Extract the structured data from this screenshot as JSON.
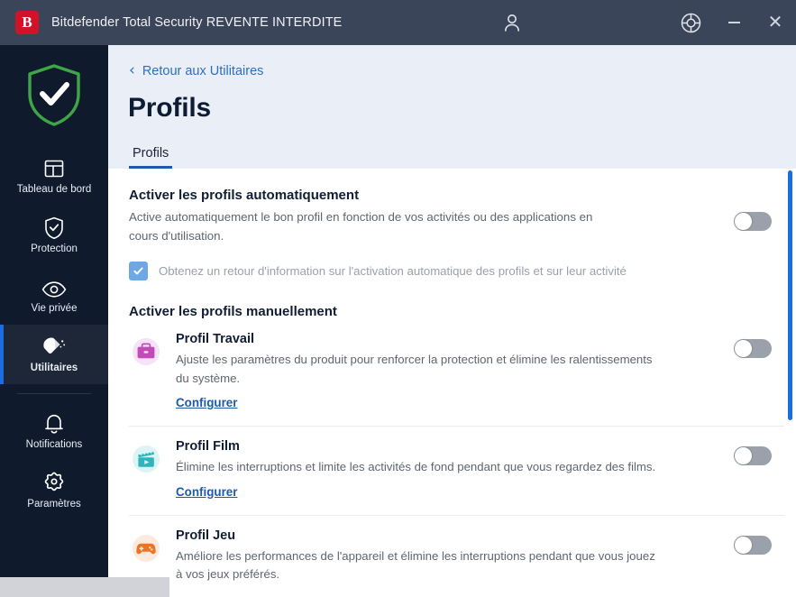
{
  "window": {
    "logo_letter": "B",
    "title": "Bitdefender Total Security REVENTE INTERDITE",
    "account_icon": "account-icon",
    "support_icon": "support-lifebuoy-icon",
    "minimize_label": "–",
    "close_label": "✕"
  },
  "sidebar": {
    "status_icon": "shield-check-icon",
    "items": [
      {
        "label": "Tableau de bord",
        "icon": "dashboard-icon",
        "active": false
      },
      {
        "label": "Protection",
        "icon": "shield-icon",
        "active": false
      },
      {
        "label": "Vie privée",
        "icon": "eye-icon",
        "active": false
      },
      {
        "label": "Utilitaires",
        "icon": "utilities-icon",
        "active": true
      },
      {
        "label": "Notifications",
        "icon": "bell-icon",
        "active": false
      },
      {
        "label": "Paramètres",
        "icon": "gear-icon",
        "active": false
      }
    ]
  },
  "header": {
    "back_label": "Retour aux Utilitaires",
    "back_icon": "chevron-left-icon",
    "title": "Profils",
    "tabs": [
      {
        "label": "Profils",
        "active": true
      }
    ]
  },
  "auto_section": {
    "title": "Activer les profils automatiquement",
    "description": "Active automatiquement le bon profil en fonction de vos activités ou des applications en cours d'utilisation.",
    "toggle_state": "off",
    "feedback_checkbox": {
      "checked": true,
      "enabled": false,
      "label": "Obtenez un retour d'information sur l'activation automatique des profils et sur leur activité"
    }
  },
  "manual_section": {
    "title": "Activer les profils manuellement",
    "configure_label": "Configurer",
    "profiles": [
      {
        "name": "Profil Travail",
        "description": "Ajuste les paramètres du produit pour renforcer la protection et élimine les ralentissements du système.",
        "icon": "briefcase-icon",
        "icon_color": "#c24bb8",
        "toggle_state": "off",
        "has_link": true
      },
      {
        "name": "Profil Film",
        "description": "Élimine les interruptions et limite les activités de fond pendant que vous regardez des films.",
        "icon": "clapperboard-play-icon",
        "icon_color": "#2fb3bd",
        "toggle_state": "off",
        "has_link": true
      },
      {
        "name": "Profil Jeu",
        "description": "Améliore les performances de l'appareil et élimine les interruptions pendant que vous jouez à vos jeux préférés.",
        "icon": "gamepad-icon",
        "icon_color": "#ef7422",
        "toggle_state": "off",
        "has_link": false
      }
    ]
  },
  "colors": {
    "titlebar": "#3b4559",
    "sidebar": "#0f1b2d",
    "accent_blue": "#1a6ee0",
    "brand_red": "#d3122a",
    "header_bg": "#eaeef7",
    "link": "#1f5aa8",
    "toggle_off": "#9aa1ab"
  },
  "scrollbar": {
    "orientation": "vertical",
    "position": "top"
  }
}
